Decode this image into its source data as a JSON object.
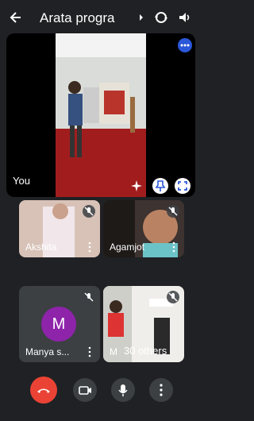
{
  "header": {
    "title": "Arata progra",
    "caret_icon": "caret-right-icon"
  },
  "main_tile": {
    "label": "You"
  },
  "participants": [
    {
      "name": "Akshita"
    },
    {
      "name": "Agamjot"
    },
    {
      "name": "Manya s...",
      "avatar_letter": "M"
    },
    {
      "name": "M",
      "extra": "30 others"
    }
  ],
  "colors": {
    "background": "#202124",
    "tile": "#3c4043",
    "hangup": "#ea4335",
    "accent_blue": "#2b57d9",
    "avatar": "#8e24aa"
  }
}
